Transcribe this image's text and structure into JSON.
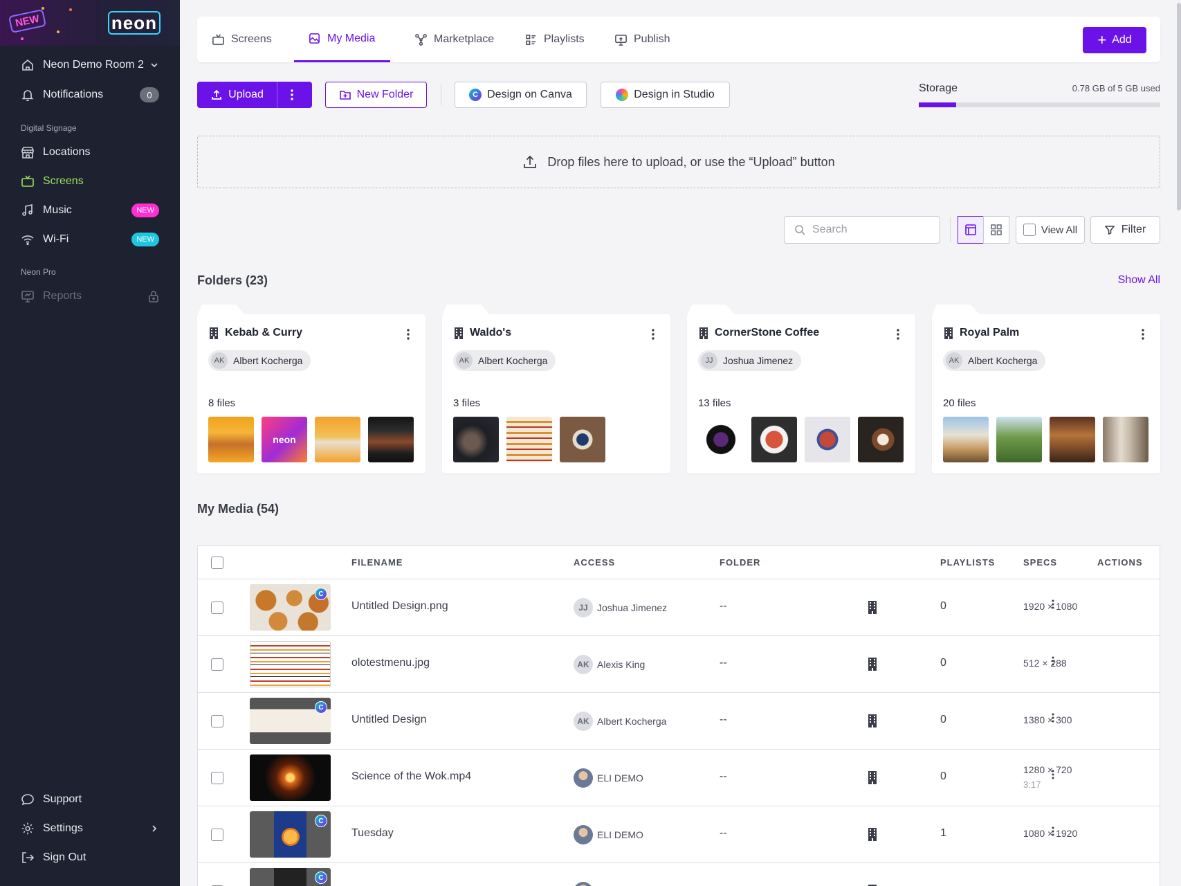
{
  "sidebar": {
    "logo_badge": "NEW",
    "brand_text": "neon",
    "room": "Neon Demo Room 2",
    "notifications_label": "Notifications",
    "notifications_count": "0",
    "section_digital_signage": "Digital Signage",
    "locations": "Locations",
    "screens": "Screens",
    "music": "Music",
    "music_badge": "NEW",
    "wifi": "Wi-Fi",
    "wifi_badge": "NEW",
    "section_pro": "Neon Pro",
    "reports": "Reports",
    "support": "Support",
    "settings": "Settings",
    "signout": "Sign Out"
  },
  "tabs": {
    "screens": "Screens",
    "my_media": "My Media",
    "marketplace": "Marketplace",
    "playlists": "Playlists",
    "publish": "Publish",
    "add": "Add"
  },
  "toolbar": {
    "upload": "Upload",
    "new_folder": "New Folder",
    "canva": "Design on Canva",
    "studio": "Design in Studio",
    "storage_label": "Storage",
    "storage_used": "0.78 GB of 5 GB used",
    "storage_fraction": 0.156
  },
  "dropzone": {
    "text": "Drop files here to upload, or use the “Upload” button"
  },
  "filters": {
    "search_placeholder": "Search",
    "view_all": "View All",
    "filter": "Filter"
  },
  "folders_section": {
    "title": "Folders (23)",
    "show_all": "Show All",
    "items": [
      {
        "name": "Kebab & Curry",
        "owner_initials": "AK",
        "owner": "Albert Kocherga",
        "files": "8 files"
      },
      {
        "name": "Waldo's",
        "owner_initials": "AK",
        "owner": "Albert Kocherga",
        "files": "3 files"
      },
      {
        "name": "CornerStone Coffee",
        "owner_initials": "JJ",
        "owner": "Joshua Jimenez",
        "files": "13 files"
      },
      {
        "name": "Royal Palm",
        "owner_initials": "AK",
        "owner": "Albert Kocherga",
        "files": "20 files"
      }
    ]
  },
  "media_section": {
    "title": "My Media (54)",
    "columns": {
      "filename": "FILENAME",
      "access": "ACCESS",
      "folder": "FOLDER",
      "playlists": "PLAYLISTS",
      "specs": "SPECS",
      "actions": "ACTIONS"
    },
    "rows": [
      {
        "filename": "Untitled Design.png",
        "initials": "JJ",
        "owner": "Joshua Jimenez",
        "folder": "--",
        "playlists": "0",
        "specs": "1920 × 1080",
        "duration": ""
      },
      {
        "filename": "olotestmenu.jpg",
        "initials": "AK",
        "owner": "Alexis King",
        "folder": "--",
        "playlists": "0",
        "specs": "512 × 288",
        "duration": ""
      },
      {
        "filename": "Untitled Design",
        "initials": "AK",
        "owner": "Albert Kocherga",
        "folder": "--",
        "playlists": "0",
        "specs": "1380 × 300",
        "duration": ""
      },
      {
        "filename": "Science of the Wok.mp4",
        "initials": "",
        "owner": "ELI DEMO",
        "folder": "--",
        "playlists": "0",
        "specs": "1280 × 720",
        "duration": "3:17"
      },
      {
        "filename": "Tuesday",
        "initials": "",
        "owner": "ELI DEMO",
        "folder": "--",
        "playlists": "1",
        "specs": "1080 × 1920",
        "duration": ""
      }
    ],
    "canva_glyph": "C"
  },
  "colors": {
    "accent": "#6a12e8",
    "sidebar_bg": "#1e2130",
    "active_nav": "#9be15d",
    "new_pink": "#ff2fd2",
    "new_cyan": "#1fc6e0"
  }
}
